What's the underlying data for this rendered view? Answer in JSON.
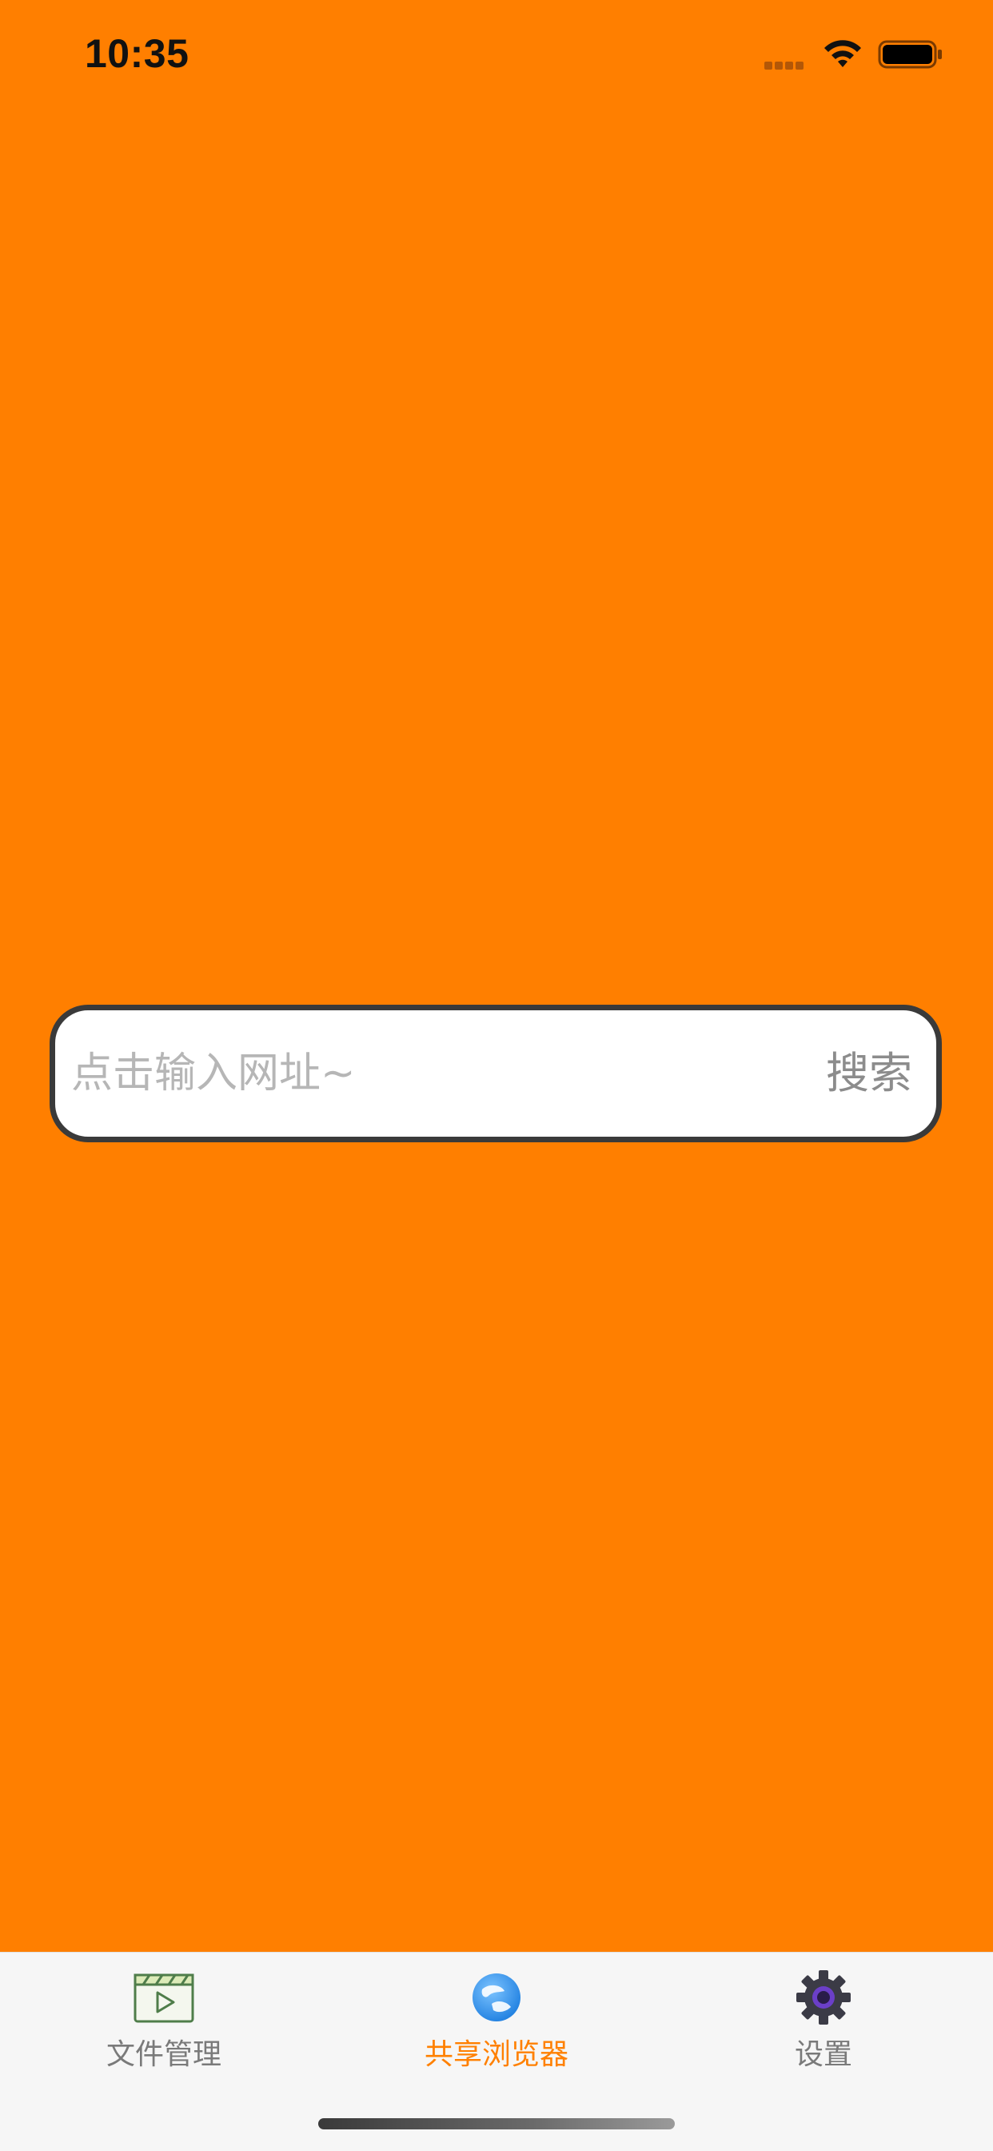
{
  "status_bar": {
    "time": "10:35"
  },
  "search": {
    "placeholder": "点击输入网址~",
    "value": "",
    "button_label": "搜索"
  },
  "tabs": [
    {
      "label": "文件管理",
      "icon": "film-clapper-icon",
      "active": false
    },
    {
      "label": "共享浏览器",
      "icon": "globe-icon",
      "active": true
    },
    {
      "label": "设置",
      "icon": "gear-icon",
      "active": false
    }
  ],
  "colors": {
    "background": "#FF7F00",
    "active_tab": "#FF8000",
    "inactive_tab": "#7A7A7A",
    "tab_bar_bg": "#F6F6F6"
  }
}
